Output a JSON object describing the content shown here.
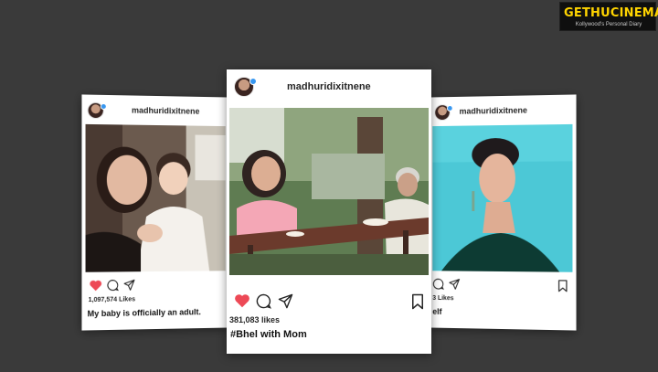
{
  "watermark": {
    "main": "GETHUCINEMA",
    "tagline": "Kollywood's Personal Diary"
  },
  "posts": [
    {
      "username": "madhuridixitnene",
      "likes": "1,097,574 Likes",
      "caption": "My baby is officially an adult."
    },
    {
      "username": "madhuridixitnene",
      "likes": "381,083 likes",
      "caption": "#Bhel with Mom"
    },
    {
      "username": "madhuridixitnene",
      "likes": "3 Likes",
      "caption": "elf"
    }
  ],
  "icons": [
    "heart-icon",
    "comment-icon",
    "share-icon",
    "bookmark-icon",
    "verified-badge-icon"
  ],
  "colors": {
    "background": "#3a3a3a",
    "like_red": "#ed4956",
    "verified_blue": "#3897f0",
    "logo_yellow": "#ffd400"
  }
}
